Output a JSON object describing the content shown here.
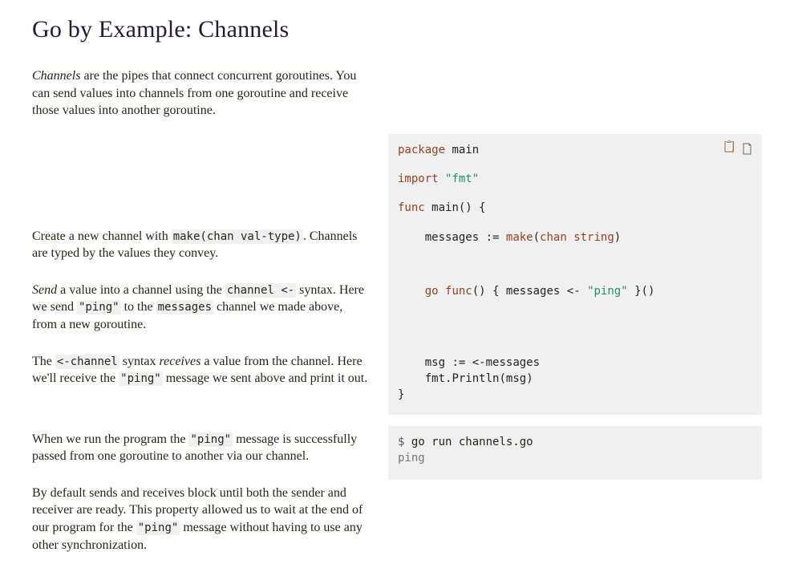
{
  "heading": {
    "site": "Go by Example",
    "sep": ": ",
    "title": "Channels"
  },
  "intro_html": "<em>Channels</em> are the pipes that connect concurrent goroutines. You can send values into channels from one goroutine and receive those values into another goroutine.",
  "rows": [
    {
      "doc_html": "",
      "code_html": "<span class='kw'>package</span> <span class='nm'>main</span>",
      "first": true,
      "has_run": true
    },
    {
      "doc_html": "",
      "code_html": "<span class='kw'>import</span> <span class='str'>\"fmt\"</span>"
    },
    {
      "doc_html": "",
      "code_html": "<span class='kw'>func</span> <span class='fn'>main</span><span class='punc'>()</span> <span class='punc'>{</span>"
    },
    {
      "doc_html": "Create a new channel with <code>make(chan val-type)</code>. Channels are typed by the values they convey.",
      "code_html": "    <span class='nm'>messages</span> <span class='op'>:=</span> <span class='bi'>make</span><span class='punc'>(</span><span class='kw'>chan</span> <span class='typ'>string</span><span class='punc'>)</span>"
    },
    {
      "doc_html": "<em>Send</em> a value into a channel using the <code>channel &lt;-</code> syntax. Here we send <code>\"ping\"</code> to the <code>messages</code> channel we made above, from a new goroutine.",
      "code_html": "    <span class='kw'>go</span> <span class='kw'>func</span><span class='punc'>()</span> <span class='punc'>{</span> <span class='nm'>messages</span> <span class='op'>&lt;-</span> <span class='str'>\"ping\"</span> <span class='punc'>}()</span>"
    },
    {
      "doc_html": "The <code>&lt;-channel</code> syntax <em>receives</em> a value from the channel. Here we'll receive the <code>\"ping\"</code> message we sent above and print it out.",
      "code_html": "    <span class='nm'>msg</span> <span class='op'>:=</span> <span class='op'>&lt;-</span><span class='nm'>messages</span>\n    <span class='nm'>fmt</span><span class='punc'>.</span><span class='fn'>Println</span><span class='punc'>(</span><span class='nm'>msg</span><span class='punc'>)</span>\n<span class='punc'>}</span>",
      "last": true
    }
  ],
  "output_rows": [
    {
      "doc_html": "When we run the program the <code>\"ping\"</code> message is successfully passed from one goroutine to another via our channel.",
      "code_html": "<span class='gp'>$</span> go run channels.go\n<span class='go-out'>ping</span>",
      "first": true,
      "last": true
    },
    {
      "doc_html": "By default sends and receives block until both the sender and receiver are ready. This property allowed us to wait at the end of our program for the <code>\"ping\"</code> message without having to use any other synchronization.",
      "code_html": "",
      "empty": true
    }
  ],
  "icons": {
    "copy": "📋",
    "run": "🌭"
  }
}
